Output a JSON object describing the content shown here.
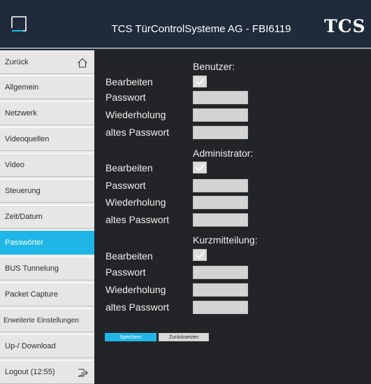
{
  "header": {
    "title": "TCS TürControlSysteme AG - FBI6119",
    "logo_text": "TCS",
    "logo_left_icon": "frame-icon"
  },
  "colors": {
    "header_bg": "#1f2b3b",
    "content_bg": "#232427",
    "sidebar_bg": "#e6e6e6",
    "accent": "#1fb6e7",
    "input_bg": "#d3d3d3"
  },
  "sidebar": {
    "items": [
      {
        "label": "Zurück",
        "icon": "home-icon"
      },
      {
        "label": "Allgemein"
      },
      {
        "label": "Netzwerk"
      },
      {
        "label": "Videoquellen"
      },
      {
        "label": "Video"
      },
      {
        "label": "Steuerung"
      },
      {
        "label": "Zeit/Datum"
      },
      {
        "label": "Passwörter",
        "active": true
      },
      {
        "label": "BUS Tunnelung"
      },
      {
        "label": "Packet Capture"
      },
      {
        "label": "Erweiterte Einstellungen"
      },
      {
        "label": "Up-/ Download"
      },
      {
        "label": "Logout (12:55)",
        "icon": "logout-icon"
      }
    ]
  },
  "sections": [
    {
      "title": "Benutzer:",
      "edit_label": "Bearbeiten",
      "edit_checked": true,
      "password_label": "Passwort",
      "password_value": "",
      "repeat_label": "Wiederholung",
      "repeat_value": "",
      "old_password_label": "altes Passwort",
      "old_password_value": ""
    },
    {
      "title": "Administrator:",
      "edit_label": "Bearbeiten",
      "edit_checked": true,
      "password_label": "Passwort",
      "password_value": "",
      "repeat_label": "Wiederholung",
      "repeat_value": "",
      "old_password_label": "altes Passwort",
      "old_password_value": ""
    },
    {
      "title": "Kurzmitteilung:",
      "edit_label": "Bearbeiten",
      "edit_checked": true,
      "password_label": "Passwort",
      "password_value": "",
      "repeat_label": "Wiederholung",
      "repeat_value": "",
      "old_password_label": "altes Passwort",
      "old_password_value": ""
    }
  ],
  "actions": {
    "save_label": "Speichern",
    "reset_label": "Zurücksetzen"
  }
}
